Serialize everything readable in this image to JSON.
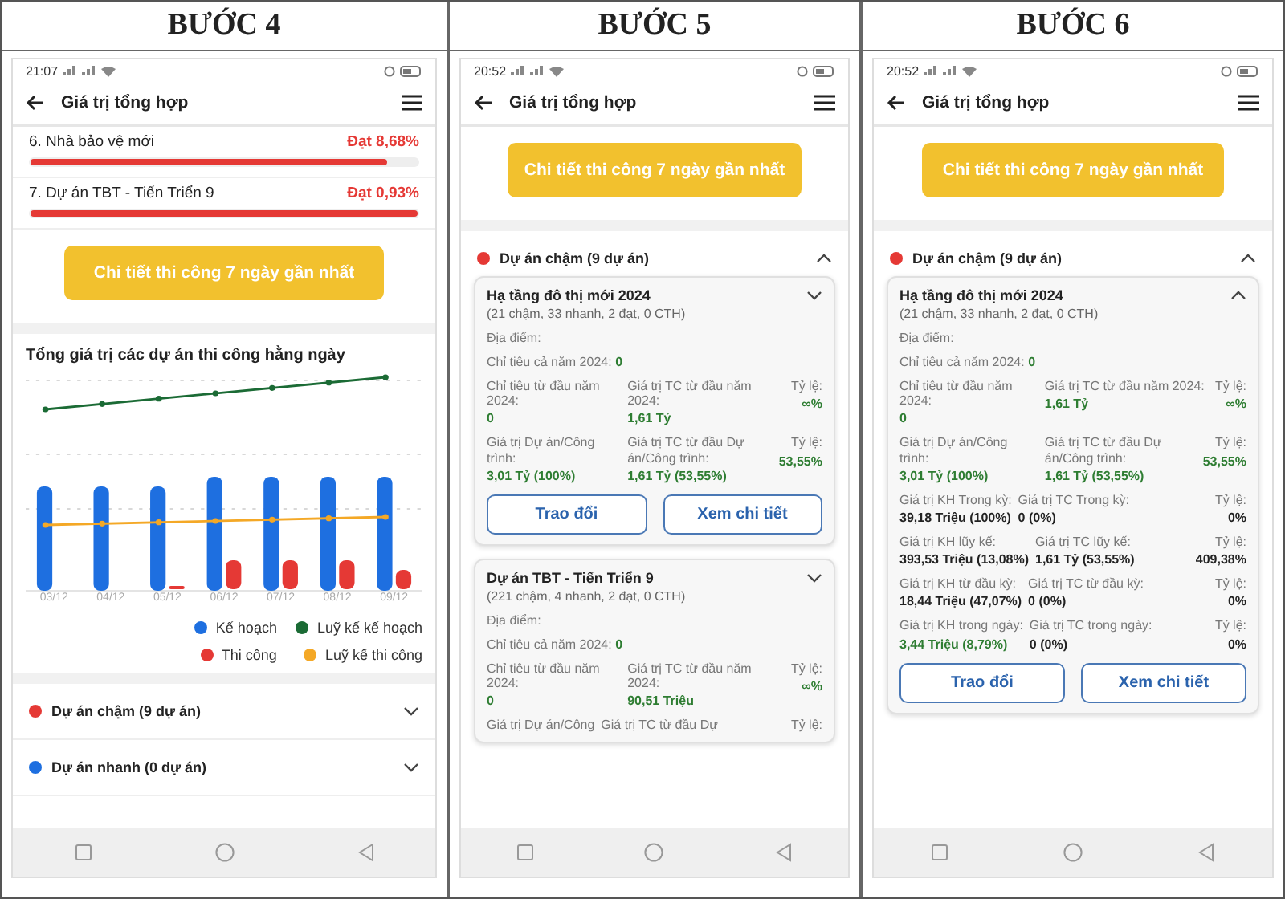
{
  "steps": [
    {
      "heading": "BƯỚC 4",
      "status_time": "21:07",
      "app_title": "Giá trị tổng hợp",
      "sections": [
        {
          "kind": "progress",
          "label": "6. Nhà bảo vệ mới",
          "reading": "Đạt 8,68%",
          "level": 0.92
        },
        {
          "kind": "progress",
          "label": "7. Dự án TBT - Tiến Triển 9",
          "reading": "Đạt 0,93%",
          "level": 1
        },
        {
          "kind": "action_button",
          "label": "Chi tiết thi công 7 ngày gần nhất"
        },
        {
          "kind": "chart",
          "title": "Tổng giá trị các dự án thi công hằng ngày",
          "x_labels": [
            "03/12",
            "04/12",
            "05/12",
            "06/12",
            "07/12",
            "08/12",
            "09/12"
          ],
          "legend": [
            {
              "label": "Kế hoạch",
              "color": "#1e6fe0"
            },
            {
              "label": "Luỹ kế kế hoạch",
              "color": "#1b6b35"
            },
            {
              "label": "Thi công",
              "color": "#e53935"
            },
            {
              "label": "Luỹ kế thi công",
              "color": "#f4a826"
            }
          ]
        },
        {
          "kind": "groups",
          "items": [
            {
              "label": "Dự án chậm (9 dự án)",
              "color": "#e53935",
              "expanded": false
            },
            {
              "label": "Dự án nhanh (0 dự án)",
              "color": "#1e6fe0",
              "expanded": false
            }
          ]
        }
      ]
    },
    {
      "heading": "BƯỚC 5",
      "status_time": "20:52",
      "app_title": "Giá trị tổng hợp",
      "sections": [
        {
          "kind": "action_button",
          "label": "Chi tiết thi công 7 ngày gần nhất"
        },
        {
          "kind": "groups",
          "items": [
            {
              "label": "Dự án chậm (9 dự án)",
              "color": "#e53935",
              "expanded": true,
              "projects": [
                {
                  "title": "Hạ tầng đô thị mới 2024",
                  "summary": "(21 chậm, 33 nhanh, 2 đạt, 0 CTH)",
                  "expanded": false,
                  "location_label": "Địa điểm:",
                  "target_label": "Chỉ tiêu cả năm 2024:",
                  "target_value": "0",
                  "rows": [
                    [
                      {
                        "label": "Chỉ tiêu từ đầu năm 2024:",
                        "value": "0",
                        "green": true
                      },
                      {
                        "label": "Giá trị TC từ đầu năm 2024:",
                        "value": "1,61 Tỷ",
                        "green": true
                      },
                      {
                        "label": "Tỷ lệ:",
                        "value": "∞%",
                        "green": true
                      }
                    ],
                    [
                      {
                        "label": "Giá trị Dự án/Công trình:",
                        "value": "3,01 Tỷ (100%)",
                        "green": true
                      },
                      {
                        "label": "Giá trị TC từ đầu Dự án/Công trình:",
                        "value": "1,61 Tỷ (53,55%)",
                        "green": true
                      },
                      {
                        "label": "Tỷ lệ:",
                        "value": "53,55%",
                        "green": true
                      }
                    ]
                  ],
                  "actions": [
                    "Trao đổi",
                    "Xem chi tiết"
                  ]
                },
                {
                  "title": "Dự án TBT - Tiến Triển 9",
                  "summary": "(221 chậm, 4 nhanh, 2 đạt, 0 CTH)",
                  "expanded": false,
                  "location_label": "Địa điểm:",
                  "target_label": "Chỉ tiêu cả năm 2024:",
                  "target_value": "0",
                  "rows": [
                    [
                      {
                        "label": "Chỉ tiêu từ đầu năm 2024:",
                        "value": "0",
                        "green": true
                      },
                      {
                        "label": "Giá trị TC từ đầu năm 2024:",
                        "value": "90,51 Triệu",
                        "green": true
                      },
                      {
                        "label": "Tỷ lệ:",
                        "value": "∞%",
                        "green": true
                      }
                    ],
                    [
                      {
                        "label": "Giá trị Dự án/Công"
                      },
                      {
                        "label": "Giá trị TC từ đầu Dự"
                      },
                      {
                        "label": "Tỷ lệ:"
                      }
                    ]
                  ]
                }
              ]
            }
          ]
        }
      ]
    },
    {
      "heading": "BƯỚC 6",
      "status_time": "20:52",
      "app_title": "Giá trị tổng hợp",
      "sections": [
        {
          "kind": "action_button",
          "label": "Chi tiết thi công 7 ngày gần nhất"
        },
        {
          "kind": "groups",
          "items": [
            {
              "label": "Dự án chậm (9 dự án)",
              "color": "#e53935",
              "expanded": true,
              "projects": [
                {
                  "title": "Hạ tầng đô thị mới 2024",
                  "summary": "(21 chậm, 33 nhanh, 2 đạt, 0 CTH)",
                  "expanded": true,
                  "location_label": "Địa điểm:",
                  "target_label": "Chỉ tiêu cả năm 2024:",
                  "target_value": "0",
                  "rows": [
                    [
                      {
                        "label": "Chỉ tiêu từ đầu năm 2024:",
                        "value": "0",
                        "green": true
                      },
                      {
                        "label": "Giá trị TC từ đầu năm 2024:",
                        "value": "1,61 Tỷ",
                        "green": true
                      },
                      {
                        "label": "Tỷ lệ:",
                        "value": "∞%",
                        "green": true
                      }
                    ],
                    [
                      {
                        "label": "Giá trị Dự án/Công trình:",
                        "value": "3,01 Tỷ (100%)",
                        "green": true
                      },
                      {
                        "label": "Giá trị TC từ đầu Dự án/Công trình:",
                        "value": "1,61 Tỷ (53,55%)",
                        "green": true
                      },
                      {
                        "label": "Tỷ lệ:",
                        "value": "53,55%",
                        "green": true
                      }
                    ],
                    [
                      {
                        "label": "Giá trị KH Trong kỳ:",
                        "value": "39,18 Triệu (100%)",
                        "green": false
                      },
                      {
                        "label": "Giá trị TC Trong kỳ:",
                        "value": "0 (0%)",
                        "green": false
                      },
                      {
                        "label": "Tỷ lệ:",
                        "value": "0%",
                        "green": false
                      }
                    ],
                    [
                      {
                        "label": "Giá trị KH lũy kế:",
                        "value": "393,53 Triệu (13,08%)",
                        "green": false
                      },
                      {
                        "label": "Giá trị TC lũy kế:",
                        "value": "1,61 Tỷ (53,55%)",
                        "green": false
                      },
                      {
                        "label": "Tỷ lệ:",
                        "value": "409,38%",
                        "green": false
                      }
                    ],
                    [
                      {
                        "label": "Giá trị KH từ đầu kỳ:",
                        "value": "18,44 Triệu (47,07%)",
                        "green": false
                      },
                      {
                        "label": "Giá trị TC từ đầu kỳ:",
                        "value": "0 (0%)",
                        "green": false
                      },
                      {
                        "label": "Tỷ lệ:",
                        "value": "0%",
                        "green": false
                      }
                    ],
                    [
                      {
                        "label": "Giá trị KH trong ngày:",
                        "value": "3,44 Triệu (8,79%)",
                        "green": true
                      },
                      {
                        "label": "Giá trị TC trong ngày:",
                        "value": "0 (0%)",
                        "green": false
                      },
                      {
                        "label": "Tỷ lệ:",
                        "value": "0%",
                        "green": false
                      }
                    ]
                  ],
                  "actions": [
                    "Trao đổi",
                    "Xem chi tiết"
                  ]
                }
              ]
            }
          ]
        }
      ]
    }
  ]
}
